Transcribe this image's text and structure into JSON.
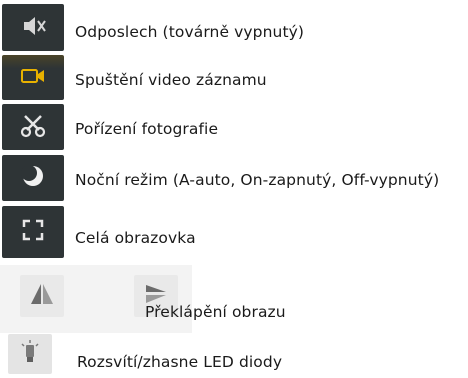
{
  "items": [
    {
      "label": "Odposlech (továrně vypnutý)",
      "icon": "muted-speaker-icon"
    },
    {
      "label": "Spuštění video záznamu",
      "icon": "video-camera-icon"
    },
    {
      "label": "Pořízení fotografie",
      "icon": "scissors-icon"
    },
    {
      "label": "Noční režim (A-auto, On-zapnutý, Off-vypnutý)",
      "icon": "night-mode-icon"
    },
    {
      "label": "Celá obrazovka",
      "icon": "fullscreen-icon"
    },
    {
      "label": "Překlápění obrazu",
      "icons": [
        "flip-horizontal-icon",
        "flip-vertical-icon"
      ]
    },
    {
      "label": "Rozsvítí/zhasne LED diody",
      "icon": "led-light-icon"
    }
  ],
  "colors": {
    "dark_tile": "#2f3537",
    "icon_light": "#e6e6e6",
    "icon_gold": "#e8b100",
    "light_button": "#e9e9e9",
    "icon_gray": "#6b6b6b"
  }
}
